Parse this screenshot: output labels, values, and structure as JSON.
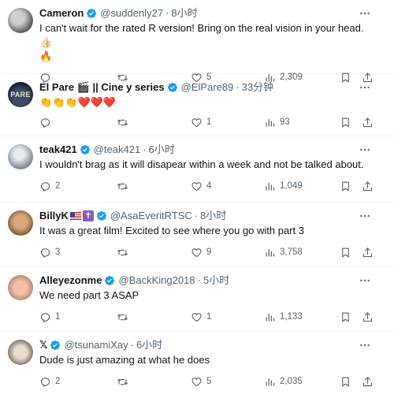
{
  "tweets": [
    {
      "name": "Cameron",
      "handle": "@suddenly27",
      "time": "8小时",
      "text": "I can't wait for the rated R version!  Bring on the real vision in your head. 👍🏻",
      "text2": "🔥",
      "reply": "",
      "retweet": "",
      "like": "5",
      "views": "2,309"
    },
    {
      "name": "El Pare 🎬 || Cine y series",
      "handle": "@ElPare89",
      "time": "33分钟",
      "text": "👏👏👏❤️❤️❤️",
      "reply": "",
      "retweet": "",
      "like": "1",
      "views": "93"
    },
    {
      "name": "teak421",
      "handle": "@teak421",
      "time": "6小时",
      "text": "I wouldn't brag as it will disapear within a week and not be talked about.",
      "reply": "2",
      "retweet": "",
      "like": "4",
      "views": "1,049"
    },
    {
      "name": "BillyK",
      "handle": "@AsaEveritRTSC",
      "time": "8小时",
      "text": "It was a great film! Excited to see where you go with part 3",
      "reply": "3",
      "retweet": "",
      "like": "9",
      "views": "3,758"
    },
    {
      "name": "Alleyezonme",
      "handle": "@BackKing2018",
      "time": "5小时",
      "text": "We need part 3 ASAP",
      "reply": "1",
      "retweet": "",
      "like": "1",
      "views": "1,133"
    },
    {
      "name": "𝕏",
      "handle": "@tsunamiXay",
      "time": "6小时",
      "text": "Dude is just amazing at what he does",
      "reply": "2",
      "retweet": "",
      "like": "5",
      "views": "2,035"
    }
  ],
  "avatar_text": {
    "el_pare": "PARE"
  },
  "dot": "·",
  "cross_glyph": "✝",
  "icons": {
    "verified": "verified-badge-icon",
    "more": "more-horizontal-icon",
    "reply": "reply-icon",
    "retweet": "retweet-icon",
    "like": "heart-icon",
    "views": "views-chart-icon",
    "bookmark": "bookmark-icon",
    "share": "share-icon"
  },
  "colors": {
    "verified": "#1d9bf0",
    "text": "#0f1419",
    "muted": "#536471",
    "divider": "#eff3f4"
  }
}
